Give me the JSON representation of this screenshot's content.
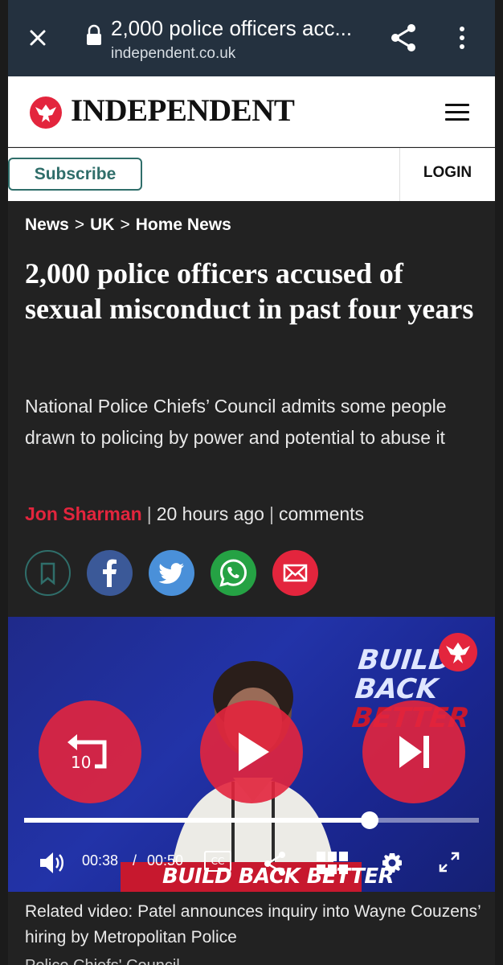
{
  "browser": {
    "tab_title": "2,000 police officers acc...",
    "url": "independent.co.uk"
  },
  "masthead": {
    "brand": "INDEPENDENT"
  },
  "subscribe_row": {
    "subscribe_label": "Subscribe",
    "login_label": "LOGIN"
  },
  "breadcrumb": [
    "News",
    "UK",
    "Home News"
  ],
  "breadcrumb_sep": ">",
  "article": {
    "headline": "2,000 police officers accused of sexual misconduct in past four years",
    "standfirst": "National Police Chiefs’ Council admits some people drawn to policing by power and potential to abuse it",
    "author": "Jon Sharman",
    "time_ago": "20 hours ago",
    "comments_label": "comments"
  },
  "social": {
    "icons": [
      "bookmark-icon",
      "facebook-icon",
      "twitter-icon",
      "whatsapp-icon",
      "email-icon"
    ],
    "colors": {
      "bookmark": "#2f6e6a",
      "facebook": "#3b5998",
      "twitter": "#4a90d9",
      "whatsapp": "#25a244",
      "email": "#e3253d"
    }
  },
  "video": {
    "overlay_text": [
      "BUILD",
      "BACK",
      "BETTER"
    ],
    "podium_text": "BUILD BACK BETTER",
    "rewind_label": "10",
    "current_time": "00:38",
    "time_sep": "/",
    "duration": "00:50",
    "progress": 0.76,
    "cc_label": "CC",
    "accent": "#e3253d"
  },
  "caption": "Related video: Patel announces inquiry into Wayne Couzens’ hiring by Metropolitan Police",
  "cut_text": "Police Chiefs' Council"
}
